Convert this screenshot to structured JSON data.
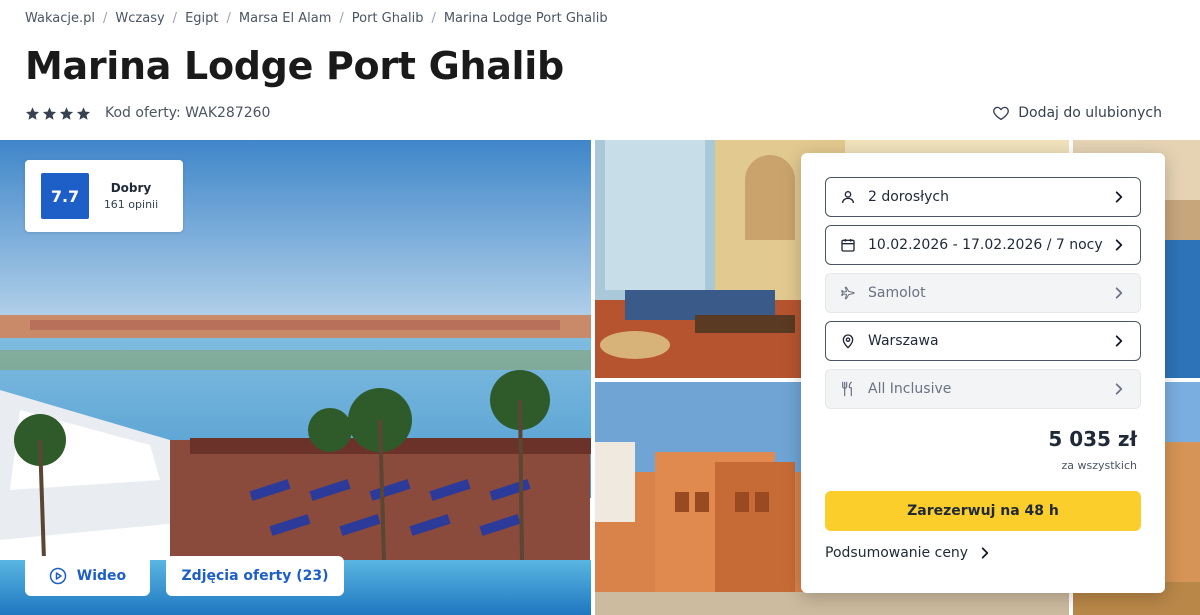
{
  "breadcrumb": [
    {
      "label": "Wakacje.pl"
    },
    {
      "label": "Wczasy"
    },
    {
      "label": "Egipt"
    },
    {
      "label": "Marsa El Alam"
    },
    {
      "label": "Port Ghalib"
    },
    {
      "label": "Marina Lodge Port Ghalib"
    }
  ],
  "hotel": {
    "title": "Marina Lodge Port Ghalib",
    "stars": 4,
    "offer_code": "Kod oferty: WAK287260",
    "favorite_label": "Dodaj do ulubionych"
  },
  "rating": {
    "score": "7.7",
    "label": "Dobry",
    "count": "161 opinii",
    "color": "#1d5fc6"
  },
  "gallery": {
    "video_label": "Wideo",
    "photos_label": "Zdjęcia oferty (23)"
  },
  "booking": {
    "fields": [
      {
        "icon": "person-icon",
        "label": "2 dorosłych",
        "state": "active"
      },
      {
        "icon": "calendar-icon",
        "label": "10.02.2026 - 17.02.2026 / 7 nocy",
        "state": "active"
      },
      {
        "icon": "plane-icon",
        "label": "Samolot",
        "state": "disabled"
      },
      {
        "icon": "location-pin-icon",
        "label": "Warszawa",
        "state": "active"
      },
      {
        "icon": "cutlery-icon",
        "label": "All Inclusive",
        "state": "disabled"
      }
    ],
    "price": "5 035 zł",
    "price_note": "za wszystkich",
    "cta_label": "Zarezerwuj na 48 h",
    "cta_color": "#fbce2c",
    "summary_label": "Podsumowanie ceny"
  }
}
